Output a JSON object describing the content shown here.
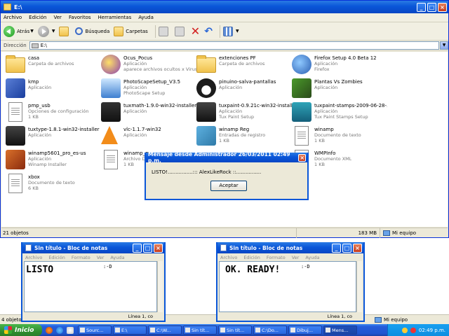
{
  "explorer": {
    "title": "E:\\",
    "menu": [
      "Archivo",
      "Edición",
      "Ver",
      "Favoritos",
      "Herramientas",
      "Ayuda"
    ],
    "toolbar": {
      "back": "Atrás",
      "search": "Búsqueda",
      "folders": "Carpetas"
    },
    "address": {
      "label": "Dirección",
      "value": "E:\\"
    },
    "items": [
      {
        "name": "casa",
        "desc": "Carpeta de archivos",
        "desc2": "",
        "icon": "folder-icon"
      },
      {
        "name": "Ocus_Pocus",
        "desc": "Aplicación",
        "desc2": "aparece archivos ocultos x Virus",
        "icon": "hocus-pocus-icon"
      },
      {
        "name": "extenciones PF",
        "desc": "Carpeta de archivos",
        "desc2": "",
        "icon": "folder-icon"
      },
      {
        "name": "Firefox Setup 4.0 Beta 12",
        "desc": "Aplicación",
        "desc2": "Firefox",
        "icon": "firefox-setup-icon"
      },
      {
        "name": "kmp",
        "desc": "Aplicación",
        "desc2": "",
        "icon": "kmp-icon"
      },
      {
        "name": "PhotoScapeSetup_V3.5",
        "desc": "Aplicación",
        "desc2": "PhotoScape Setup",
        "icon": "photoscape-icon"
      },
      {
        "name": "pinuino-salva-pantallas",
        "desc": "Aplicación",
        "desc2": "",
        "icon": "penguin-icon"
      },
      {
        "name": "Plantas Vs Zombies",
        "desc": "Aplicación",
        "desc2": "",
        "icon": "plants-vs-zombies-icon"
      },
      {
        "name": "pmp_usb",
        "desc": "Opciones de configuración",
        "desc2": "1 KB",
        "icon": "config-file-icon"
      },
      {
        "name": "tuxmath-1.9.0-win32-installer",
        "desc": "Aplicación",
        "desc2": "",
        "icon": "tuxmath-icon"
      },
      {
        "name": "tuxpaint-0.9.21c-win32-installer",
        "desc": "Aplicación",
        "desc2": "Tux Paint Setup",
        "icon": "tuxpaint-icon"
      },
      {
        "name": "tuxpaint-stamps-2009-06-28-...",
        "desc": "Aplicación",
        "desc2": "Tux Paint Stamps Setup",
        "icon": "tuxpaint-stamps-icon"
      },
      {
        "name": "tuxtype-1.8.1-win32-installer",
        "desc": "Aplicación",
        "desc2": "",
        "icon": "tuxtype-icon"
      },
      {
        "name": "vlc-1.1.7-win32",
        "desc": "Aplicación",
        "desc2": "",
        "icon": "vlc-cone-icon"
      },
      {
        "name": "winamp Reg",
        "desc": "Entradas de registro",
        "desc2": "1 KB",
        "icon": "registry-icon"
      },
      {
        "name": "winamp",
        "desc": "Documento de texto",
        "desc2": "1 KB",
        "icon": "text-document-icon"
      },
      {
        "name": "winamp5601_pro_es-us",
        "desc": "Aplicación",
        "desc2": "Winamp Installer",
        "icon": "winamp-installer-icon"
      },
      {
        "name": "winamp_m",
        "desc": "Archivo D",
        "desc2": "1 KB",
        "icon": "generic-file-icon"
      },
      {
        "name": "",
        "desc": "",
        "desc2": "",
        "icon": ""
      },
      {
        "name": "WMPInfo",
        "desc": "Documento XML",
        "desc2": "1 KB",
        "icon": "xml-document-icon"
      },
      {
        "name": "xbox",
        "desc": "Documento de texto",
        "desc2": "6 KB",
        "icon": "text-document-icon"
      }
    ],
    "status": {
      "count": "21 objetos",
      "size": "183 MB",
      "location": "Mi equipo"
    }
  },
  "lower_explorer": {
    "status": {
      "count": "4 objetos",
      "location": "Mi equipo"
    }
  },
  "notepad_left": {
    "title": "Sin título - Bloc de notas",
    "menu": [
      "Archivo",
      "Edición",
      "Formato",
      "Ver",
      "Ayuda"
    ],
    "big_text": "LISTO",
    "small_text": ":-D",
    "status": "Línea 1, co"
  },
  "notepad_right": {
    "title": "Sin título - Bloc de notas",
    "menu": [
      "Archivo",
      "Edición",
      "Formato",
      "Ver",
      "Ayuda"
    ],
    "big_text": "OK.  READY!",
    "small_text": ":-D",
    "status": "Línea 1, co"
  },
  "dialog": {
    "title": "Mensaje desde Administrador 26/03/2011 02:49 p.m.",
    "message": "LISTO!................::: AlexLikeRock ::................",
    "ok_label": "Aceptar"
  },
  "taskbar": {
    "start_label": "Inicio",
    "tasks": [
      "Sourc...",
      "E:\\",
      "C:\\W...",
      "Sin tít...",
      "Sin tít...",
      "C:\\Do...",
      "Dibuj...",
      "Mens..."
    ],
    "clock": "02:49 p.m."
  }
}
